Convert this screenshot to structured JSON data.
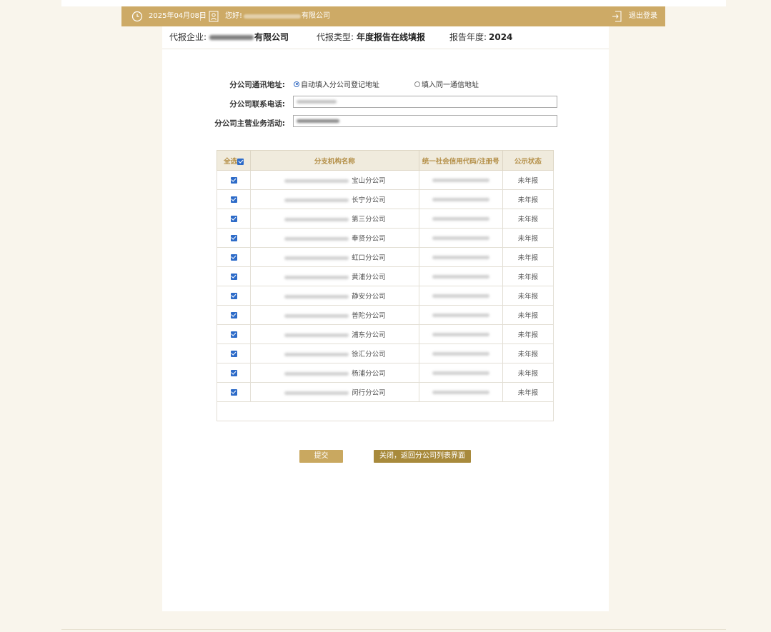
{
  "header": {
    "date": "2025年04月08日",
    "greeting": "您好!",
    "company_suffix": "有限公司",
    "logout": "退出登录"
  },
  "info": {
    "company_label": "代报企业:",
    "company_suffix": "有限公司",
    "type_label": "代报类型:",
    "type_value": "年度报告在线填报",
    "year_label": "报告年度:",
    "year_value": "2024"
  },
  "form": {
    "address_label": "分公司通讯地址:",
    "address_option_1": "自动填入分公司登记地址",
    "address_option_2": "填入同一通信地址",
    "phone_label": "分公司联系电话:",
    "business_label": "分公司主营业务活动:"
  },
  "table": {
    "headers": [
      "全选",
      "分支机构名称",
      "统一社会信用代码/注册号",
      "公示状态"
    ],
    "rows": [
      {
        "name": "宝山分公司",
        "status": "未年报"
      },
      {
        "name": "长宁分公司",
        "status": "未年报"
      },
      {
        "name": "第三分公司",
        "status": "未年报"
      },
      {
        "name": "奉贤分公司",
        "status": "未年报"
      },
      {
        "name": "虹口分公司",
        "status": "未年报"
      },
      {
        "name": "黄浦分公司",
        "status": "未年报"
      },
      {
        "name": "静安分公司",
        "status": "未年报"
      },
      {
        "name": "普陀分公司",
        "status": "未年报"
      },
      {
        "name": "浦东分公司",
        "status": "未年报"
      },
      {
        "name": "徐汇分公司",
        "status": "未年报"
      },
      {
        "name": "杨浦分公司",
        "status": "未年报"
      },
      {
        "name": "闵行分公司",
        "status": "未年报"
      }
    ]
  },
  "buttons": {
    "submit": "提交",
    "close": "关闭，返回分公司列表界面"
  },
  "colors": {
    "header_gold": "#cdaa66",
    "checkbox_blue": "#2d6bc8",
    "close_button": "#a88a3c"
  }
}
